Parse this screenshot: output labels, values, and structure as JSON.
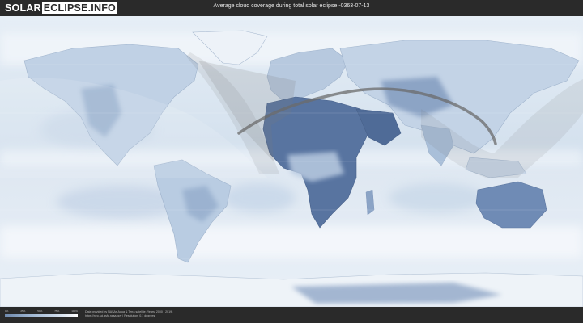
{
  "header": {
    "logo_part1": "SOLAR",
    "logo_part2": "ECLIPSE.INFO",
    "title": "Average cloud coverage during total solar eclipse -0363-07-13"
  },
  "legend": {
    "ticks": [
      "0%",
      "25%",
      "50%",
      "75%",
      "100%"
    ],
    "colors": [
      "#6f89ad",
      "#9fb6d2",
      "#cbd9e9",
      "#ffffff"
    ]
  },
  "footer": {
    "credit_line1": "Data provided by NASAs Aqua & Terra satellite (Years: 2000 - 2019)",
    "credit_line2": "https://neo.sci.gsfc.nasa.gov | Resolution: 0.1 degrees"
  },
  "map": {
    "ocean_color": "#dbe6f1",
    "cloudy_color": "#f4f8fc",
    "clear_land_color": "#4f6c98",
    "night_shade": "#808080",
    "eclipse_path_color": "#6b6b6b"
  }
}
